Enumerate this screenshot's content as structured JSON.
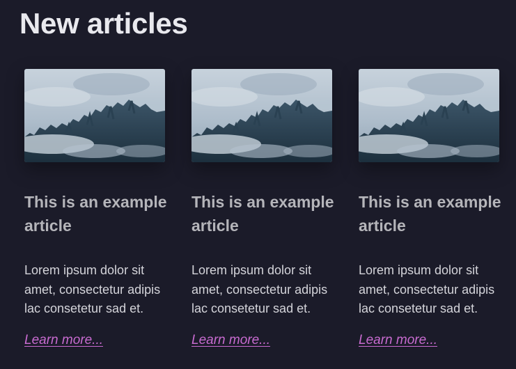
{
  "header": {
    "title": "New articles"
  },
  "articles": [
    {
      "title": "This is an example article",
      "body": "Lorem ipsum dolor sit amet, consectetur adipis lac consetetur sad et.",
      "link": "Learn more...",
      "image": "misty-forest-photo"
    },
    {
      "title": "This is an example article",
      "body": "Lorem ipsum dolor sit amet, consectetur adipis lac consetetur sad et.",
      "link": "Learn more...",
      "image": "misty-forest-photo"
    },
    {
      "title": "This is an example article",
      "body": "Lorem ipsum dolor sit amet, consectetur adipis lac consetetur sad et.",
      "link": "Learn more...",
      "image": "misty-forest-photo"
    }
  ],
  "colors": {
    "background": "#1b1b29",
    "title": "#e9e9ee",
    "card_title": "#b5b5ba",
    "body_text": "#d4d4da",
    "link": "#c86bd0"
  }
}
